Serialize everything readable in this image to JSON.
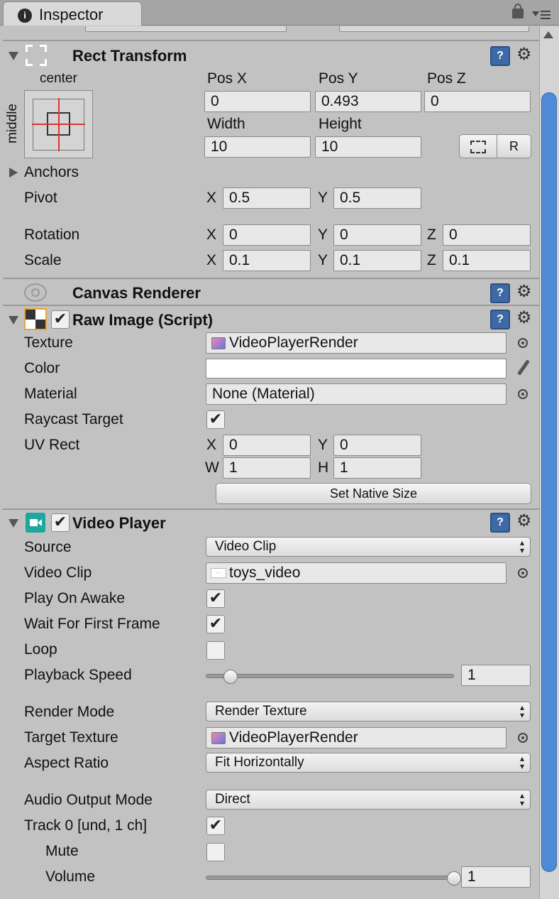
{
  "window": {
    "tab_title": "Inspector"
  },
  "rect_transform": {
    "title": "Rect Transform",
    "anchor_top_label": "center",
    "anchor_side_label": "middle",
    "pos_x_label": "Pos X",
    "pos_y_label": "Pos Y",
    "pos_z_label": "Pos Z",
    "pos_x": "0",
    "pos_y": "0.493",
    "pos_z": "0",
    "width_label": "Width",
    "height_label": "Height",
    "width": "10",
    "height": "10",
    "anchors_label": "Anchors",
    "pivot_label": "Pivot",
    "pivot_x": "0.5",
    "pivot_y": "0.5",
    "rotation_label": "Rotation",
    "rot_x": "0",
    "rot_y": "0",
    "rot_z": "0",
    "scale_label": "Scale",
    "scale_x": "0.1",
    "scale_y": "0.1",
    "scale_z": "0.1",
    "x_label": "X",
    "y_label": "Y",
    "z_label": "Z",
    "raw_edit_glyph": "R"
  },
  "canvas_renderer": {
    "title": "Canvas Renderer"
  },
  "raw_image": {
    "title": "Raw Image (Script)",
    "texture_label": "Texture",
    "texture_value": "VideoPlayerRender",
    "color_label": "Color",
    "material_label": "Material",
    "material_value": "None (Material)",
    "raycast_label": "Raycast Target",
    "raycast_checked": true,
    "uvrect_label": "UV Rect",
    "uv_x_label": "X",
    "uv_x": "0",
    "uv_y_label": "Y",
    "uv_y": "0",
    "uv_w_label": "W",
    "uv_w": "1",
    "uv_h_label": "H",
    "uv_h": "1",
    "native_size_button": "Set Native Size"
  },
  "video_player": {
    "title": "Video Player",
    "source_label": "Source",
    "source_value": "Video Clip",
    "clip_label": "Video Clip",
    "clip_value": "toys_video",
    "play_on_awake_label": "Play On Awake",
    "wait_first_frame_label": "Wait For First Frame",
    "loop_label": "Loop",
    "playback_speed_label": "Playback Speed",
    "playback_speed": "1",
    "playback_speed_fraction": 0.1,
    "render_mode_label": "Render Mode",
    "render_mode_value": "Render Texture",
    "target_texture_label": "Target Texture",
    "target_texture_value": "VideoPlayerRender",
    "aspect_ratio_label": "Aspect Ratio",
    "aspect_ratio_value": "Fit Horizontally",
    "audio_output_label": "Audio Output Mode",
    "audio_output_value": "Direct",
    "track_label": "Track 0 [und, 1 ch]",
    "mute_label": "Mute",
    "volume_label": "Volume",
    "volume": "1",
    "volume_fraction": 1.0
  },
  "glyphs": {
    "check": "✔",
    "gear": "⚙",
    "help": "?",
    "dropdown": "▴▾"
  }
}
